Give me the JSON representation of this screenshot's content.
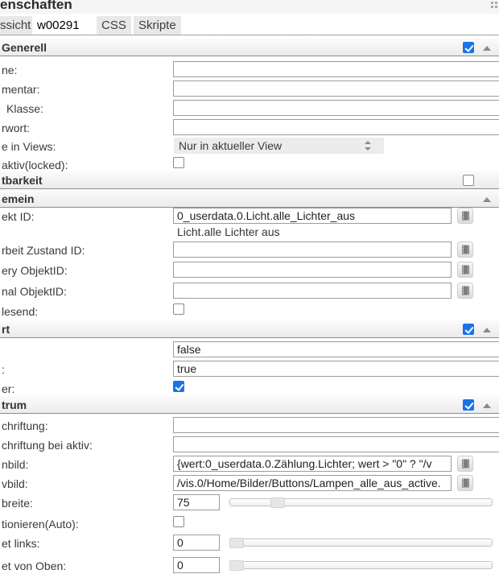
{
  "window": {
    "title": "enschaften"
  },
  "tabs": {
    "items": [
      {
        "label": "ssicht",
        "active": false
      },
      {
        "label": "w00291",
        "active": true
      },
      {
        "label": "CSS",
        "active": false
      },
      {
        "label": "Skripte",
        "active": false
      }
    ]
  },
  "colors": {
    "accent_blue": "#1a73e8",
    "section_border": "#8c8c8c",
    "select_bg": "#ececec"
  },
  "sections": {
    "generell": {
      "title": "Generell",
      "checked": true,
      "rows": {
        "name": {
          "label": "ne:",
          "value": ""
        },
        "kommentar": {
          "label": "mentar:",
          "value": ""
        },
        "klasse": {
          "label": "Klasse:",
          "value": ""
        },
        "passwort": {
          "label": "rwort:",
          "value": ""
        },
        "views": {
          "label": "e in Views:",
          "value": "Nur in aktueller View"
        },
        "locked": {
          "label": "aktiv(locked):",
          "checked": false
        }
      }
    },
    "sichtbarkeit": {
      "title": "tbarkeit",
      "checked": false
    },
    "allgemein": {
      "title": "emein",
      "rows": {
        "objekt_id": {
          "label": "ekt ID:",
          "value": "0_userdata.0.Licht.alle_Lichter_aus",
          "helper": "Licht.alle Lichter aus"
        },
        "zustand_id": {
          "label": "rbeit Zustand ID:",
          "value": ""
        },
        "battery_id": {
          "label": "ery ObjektID:",
          "value": ""
        },
        "signal_id": {
          "label": "nal ObjektID:",
          "value": ""
        },
        "lesend": {
          "label": "lesend:",
          "checked": false
        }
      }
    },
    "wert": {
      "title": "rt",
      "checked": true,
      "rows": {
        "wert_aus": {
          "label": "",
          "value": "false"
        },
        "wert_an": {
          "label": ":",
          "value": "true"
        },
        "inverter": {
          "label": "er:",
          "checked": true
        }
      }
    },
    "zentrum": {
      "title": "trum",
      "checked": true,
      "rows": {
        "beschriftung": {
          "label": "chriftung:",
          "value": ""
        },
        "beschriftung_aktiv": {
          "label": "chriftung bei aktiv:",
          "value": ""
        },
        "bild": {
          "label": "nbild:",
          "value": "{wert:0_userdata.0.Zählung.Lichter; wert > \"0\" ? \"/v"
        },
        "aktiv_bild": {
          "label": "vbild:",
          "value": "/vis.0/Home/Bilder/Buttons/Lampen_alle_aus_active."
        },
        "breite": {
          "label": "breite:",
          "value": "75"
        },
        "auto": {
          "label": "tionieren(Auto):",
          "checked": false
        },
        "links": {
          "label": "et links:",
          "value": "0"
        },
        "oben": {
          "label": "et von Oben:",
          "value": "0"
        }
      }
    }
  }
}
